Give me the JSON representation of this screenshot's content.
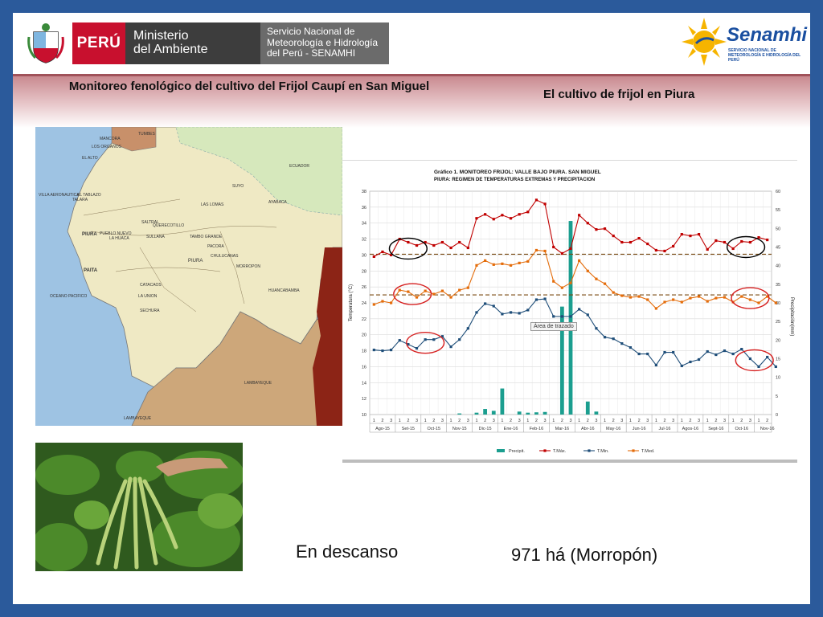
{
  "header": {
    "peru": "PERÚ",
    "ministry_line1": "Ministerio",
    "ministry_line2": "del Ambiente",
    "senamhi_line1": "Servicio Nacional de",
    "senamhi_line2": "Meteorología e Hidrología",
    "senamhi_line3": "del Perú - SENAMHI",
    "senamhi_logo": "Senamhi",
    "senamhi_logo_sub": "SERVICIO NACIONAL DE METEOROLOGÍA E HIDROLOGÍA DEL PERÚ"
  },
  "titles": {
    "left": "Monitoreo fenológico del cultivo del Frijol Caupí en San Miguel",
    "right": "El cultivo de frijol en Piura"
  },
  "map": {
    "labels": {
      "tumbes": "TUMBES",
      "ecuador": "ECUADOR",
      "oceano": "OCEANO PACIFICO",
      "lambayeque": "LAMBAYEQUE",
      "lambayeque2": "LAMBAYEQUE",
      "piura": "PIURA",
      "talara": "TALARA",
      "paita": "PAITA",
      "piura_city": "PIURA",
      "sechura": "SECHURA",
      "morropon": "MORROPON",
      "ayabaca": "AYABACA",
      "huancabamba": "HUANCABAMBA",
      "chulucanas": "CHULUCANAS",
      "sullana": "SULLANA",
      "mancora": "MANCORA",
      "los_organos": "LOS ORGANOS",
      "el_alto": "EL ALTO",
      "la_union": "LA UNION",
      "catacaos": "CATACAOS",
      "tambo_grande": "TAMBO GRANDE",
      "las_lomas": "LAS LOMAS",
      "la_huaca": "LA HUACA",
      "el_tablazo": "EL TABLAZO",
      "villa_aeronautica": "VILLA AERONAUTICA",
      "pueblo_nuevo": "PUEBLO NUEVO",
      "querecotillo": "QUERECOTILLO",
      "saltral": "SALTRAL",
      "pacora": "PACORA",
      "suyo": "SUYO"
    }
  },
  "notes": {
    "descanso": "En descanso",
    "area": "971 há (Morropón)"
  },
  "tooltip": "Área de trazado",
  "chart_data": {
    "type": "line",
    "title": "Gráfico 1. MONITOREO FRIJOL: VALLE BAJO PIURA. SAN MIGUEL",
    "subtitle": "PIURA: REGIMEN DE TEMPERATURAS EXTREMAS Y PRECIPITACION",
    "ylabel": "Temperatura (°C)",
    "ylabel_right": "Precipitación(mm)",
    "ylim": [
      10,
      38
    ],
    "ylim_right": [
      0,
      60
    ],
    "yticks": [
      10,
      12,
      14,
      16,
      18,
      20,
      22,
      24,
      26,
      28,
      30,
      32,
      34,
      36,
      38
    ],
    "yticks_right": [
      0,
      5,
      10,
      15,
      20,
      25,
      30,
      35,
      40,
      45,
      50,
      55,
      60
    ],
    "decade_labels": [
      "1",
      "2",
      "3"
    ],
    "months": [
      "Ago-15",
      "Set-15",
      "Oct-15",
      "Nov-15",
      "Dic-15",
      "Ene-16",
      "Feb-16",
      "Mar-16",
      "Abr-16",
      "May-16",
      "Jun-16",
      "Jul-16",
      "Agos-16",
      "Sept-16",
      "Oct-16",
      "Nov-16"
    ],
    "series": [
      {
        "name": "T.Máx.",
        "color": "#c00000",
        "axis": "left",
        "values": [
          29.8,
          30.4,
          30.0,
          32.0,
          31.6,
          31.2,
          31.6,
          31.2,
          31.6,
          30.9,
          31.6,
          30.9,
          34.6,
          35.1,
          34.5,
          35.0,
          34.6,
          35.1,
          35.4,
          36.9,
          36.4,
          31.0,
          30.2,
          30.8,
          35.0,
          34.0,
          33.2,
          33.3,
          32.4,
          31.6,
          31.6,
          32.1,
          31.4,
          30.6,
          30.5,
          31.1,
          32.6,
          32.4,
          32.6,
          30.7,
          31.8,
          31.6,
          30.8,
          31.7,
          31.6,
          32.2,
          31.9
        ]
      },
      {
        "name": "T.Min.",
        "color": "#1f4e79",
        "axis": "left",
        "values": [
          18.1,
          18.0,
          18.1,
          19.3,
          18.8,
          18.3,
          19.4,
          19.4,
          19.8,
          18.5,
          19.4,
          20.8,
          22.8,
          23.9,
          23.6,
          22.6,
          22.8,
          22.7,
          23.1,
          24.4,
          24.5,
          22.3,
          22.3,
          22.3,
          23.2,
          22.5,
          20.8,
          19.7,
          19.5,
          18.9,
          18.4,
          17.6,
          17.6,
          16.2,
          17.8,
          17.8,
          16.1,
          16.6,
          16.9,
          17.9,
          17.5,
          18.0,
          17.6,
          18.2,
          17.0,
          16.0,
          17.2,
          16.0
        ]
      },
      {
        "name": "T.Med.",
        "color": "#e46c0a",
        "axis": "left",
        "values": [
          23.8,
          24.2,
          24.0,
          25.6,
          25.4,
          24.7,
          25.5,
          25.1,
          25.5,
          24.7,
          25.6,
          25.9,
          28.7,
          29.3,
          28.8,
          28.9,
          28.7,
          29.0,
          29.2,
          30.6,
          30.5,
          26.7,
          25.9,
          26.5,
          29.3,
          28.0,
          27.0,
          26.4,
          25.3,
          24.9,
          24.7,
          24.8,
          24.4,
          23.3,
          24.1,
          24.4,
          24.1,
          24.6,
          24.8,
          24.2,
          24.6,
          24.7,
          24.1,
          24.8,
          24.4,
          24.0,
          24.8,
          24.0
        ]
      },
      {
        "name": "Precipit.",
        "color": "#1b9e8f",
        "axis": "right",
        "type": "bar",
        "values": [
          0,
          0,
          0,
          0,
          0,
          0,
          0,
          0,
          0,
          0,
          0.3,
          0,
          0.5,
          1.5,
          1.0,
          7.0,
          0,
          0.8,
          0.5,
          0.6,
          0.7,
          0,
          29.0,
          52.0,
          0,
          3.5,
          0.8,
          0,
          0,
          0,
          0,
          0,
          0,
          0,
          0,
          0,
          0,
          0,
          0,
          0,
          0,
          0,
          0,
          0,
          0,
          0,
          0,
          0
        ]
      }
    ],
    "reference_lines": [
      {
        "value": 30.1,
        "color": "#7a4a12",
        "style": "dashed"
      },
      {
        "value": 25.0,
        "color": "#7a4a12",
        "style": "dashed"
      }
    ],
    "legend": [
      "Precipit.",
      "T.Máx.",
      "T.Min.",
      "T.Med."
    ],
    "legend_position": "bottom",
    "grid": true
  }
}
